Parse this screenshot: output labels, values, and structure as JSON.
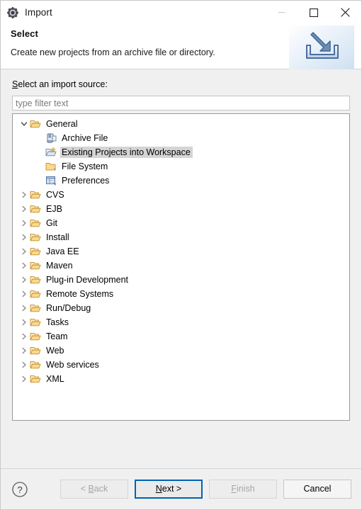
{
  "window": {
    "title": "Import",
    "icon": "eclipse-gear-icon",
    "controls": {
      "minimize": "minimize-icon",
      "maximize": "maximize-icon",
      "close": "close-icon"
    }
  },
  "header": {
    "title": "Select",
    "description": "Create new projects from an archive file or directory.",
    "icon": "import-arrow-icon"
  },
  "form": {
    "source_label_mnemonic": "S",
    "source_label_rest": "elect an import source:",
    "filter_placeholder": "type filter text",
    "filter_value": ""
  },
  "tree": {
    "nodes": [
      {
        "label": "General",
        "level": 0,
        "expanded": true,
        "twisty": "chevron-down-icon",
        "icon": "folder-open-icon",
        "selected": false
      },
      {
        "label": "Archive File",
        "level": 1,
        "expanded": null,
        "twisty": "none",
        "icon": "archive-file-icon",
        "selected": false
      },
      {
        "label": "Existing Projects into Workspace",
        "level": 1,
        "expanded": null,
        "twisty": "none",
        "icon": "projects-folder-icon",
        "selected": true
      },
      {
        "label": "File System",
        "level": 1,
        "expanded": null,
        "twisty": "none",
        "icon": "folder-closed-icon",
        "selected": false
      },
      {
        "label": "Preferences",
        "level": 1,
        "expanded": null,
        "twisty": "none",
        "icon": "preferences-grid-icon",
        "selected": false
      },
      {
        "label": "CVS",
        "level": 0,
        "expanded": false,
        "twisty": "chevron-right-icon",
        "icon": "folder-open-icon",
        "selected": false
      },
      {
        "label": "EJB",
        "level": 0,
        "expanded": false,
        "twisty": "chevron-right-icon",
        "icon": "folder-open-icon",
        "selected": false
      },
      {
        "label": "Git",
        "level": 0,
        "expanded": false,
        "twisty": "chevron-right-icon",
        "icon": "folder-open-icon",
        "selected": false
      },
      {
        "label": "Install",
        "level": 0,
        "expanded": false,
        "twisty": "chevron-right-icon",
        "icon": "folder-open-icon",
        "selected": false
      },
      {
        "label": "Java EE",
        "level": 0,
        "expanded": false,
        "twisty": "chevron-right-icon",
        "icon": "folder-open-icon",
        "selected": false
      },
      {
        "label": "Maven",
        "level": 0,
        "expanded": false,
        "twisty": "chevron-right-icon",
        "icon": "folder-open-icon",
        "selected": false
      },
      {
        "label": "Plug-in Development",
        "level": 0,
        "expanded": false,
        "twisty": "chevron-right-icon",
        "icon": "folder-open-icon",
        "selected": false
      },
      {
        "label": "Remote Systems",
        "level": 0,
        "expanded": false,
        "twisty": "chevron-right-icon",
        "icon": "folder-open-icon",
        "selected": false
      },
      {
        "label": "Run/Debug",
        "level": 0,
        "expanded": false,
        "twisty": "chevron-right-icon",
        "icon": "folder-open-icon",
        "selected": false
      },
      {
        "label": "Tasks",
        "level": 0,
        "expanded": false,
        "twisty": "chevron-right-icon",
        "icon": "folder-open-icon",
        "selected": false
      },
      {
        "label": "Team",
        "level": 0,
        "expanded": false,
        "twisty": "chevron-right-icon",
        "icon": "folder-open-icon",
        "selected": false
      },
      {
        "label": "Web",
        "level": 0,
        "expanded": false,
        "twisty": "chevron-right-icon",
        "icon": "folder-open-icon",
        "selected": false
      },
      {
        "label": "Web services",
        "level": 0,
        "expanded": false,
        "twisty": "chevron-right-icon",
        "icon": "folder-open-icon",
        "selected": false
      },
      {
        "label": "XML",
        "level": 0,
        "expanded": false,
        "twisty": "chevron-right-icon",
        "icon": "folder-open-icon",
        "selected": false
      }
    ]
  },
  "footer": {
    "help_icon": "help-question-icon",
    "buttons": [
      {
        "name": "back",
        "label": "< Back",
        "mnemonic": "B",
        "pre": "< ",
        "post": "ack",
        "state": "disabled"
      },
      {
        "name": "next",
        "label": "Next >",
        "mnemonic": "N",
        "pre": "",
        "post": "ext >",
        "state": "default"
      },
      {
        "name": "finish",
        "label": "Finish",
        "mnemonic": "F",
        "pre": "",
        "post": "inish",
        "state": "disabled"
      },
      {
        "name": "cancel",
        "label": "Cancel",
        "mnemonic": "",
        "pre": "Cancel",
        "post": "",
        "state": "enabled"
      }
    ]
  },
  "colors": {
    "accent": "#0063b1",
    "dialog_bg": "#f0f0f0",
    "panel_bg": "#ffffff",
    "selection": "#d4d4d4",
    "folder": "#f5c96a"
  }
}
